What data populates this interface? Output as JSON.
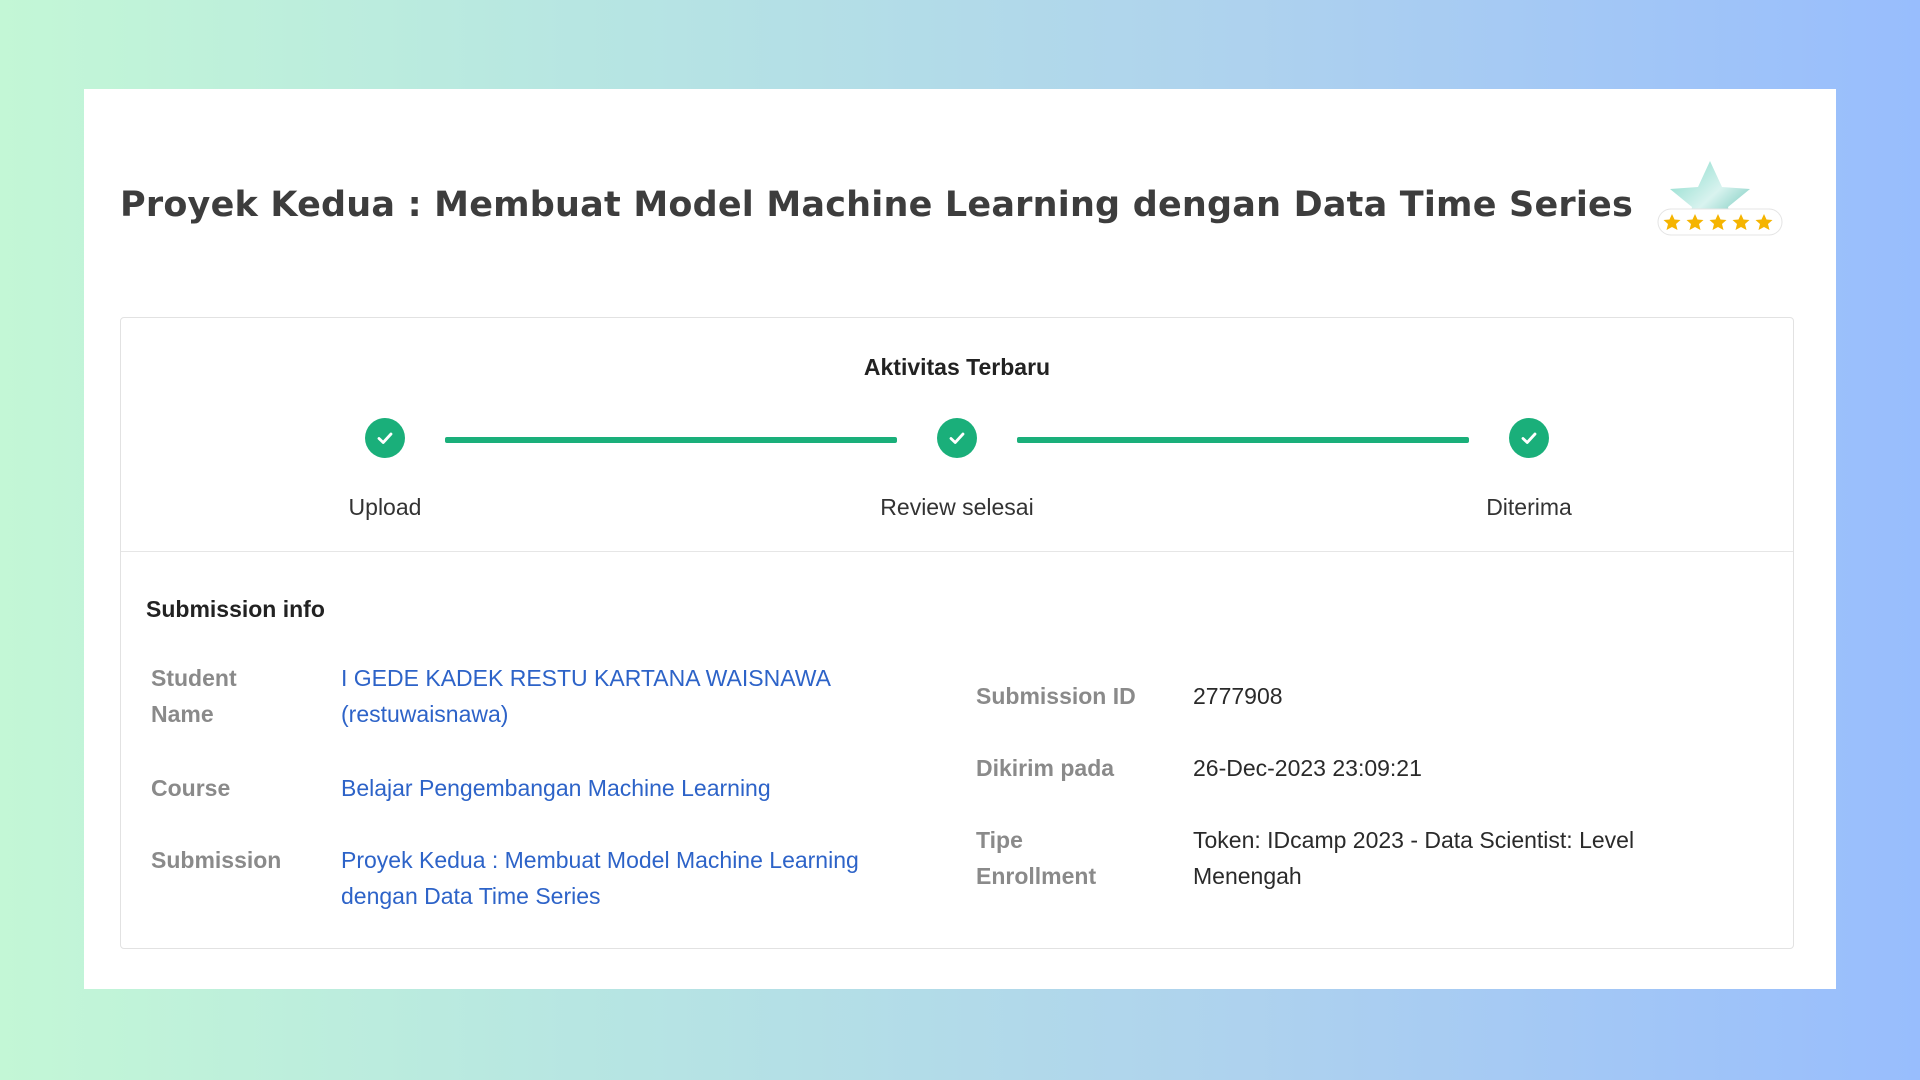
{
  "page": {
    "title": "Proyek Kedua : Membuat Model Machine Learning dengan Data Time Series"
  },
  "activity": {
    "heading": "Aktivitas Terbaru",
    "steps": [
      {
        "label": "Upload",
        "status": "done"
      },
      {
        "label": "Review selesai",
        "status": "done"
      },
      {
        "label": "Diterima",
        "status": "done"
      }
    ]
  },
  "submission_info": {
    "heading": "Submission info",
    "student_name_label": "Student Name",
    "student_name_value": "I GEDE KADEK RESTU KARTANA WAISNAWA (restuwaisnawa)",
    "course_label": "Course",
    "course_value": "Belajar Pengembangan Machine Learning",
    "submission_label": "Submission",
    "submission_value": "Proyek Kedua : Membuat Model Machine Learning dengan Data Time Series",
    "submission_id_label": "Submission ID",
    "submission_id_value": "2777908",
    "sent_at_label": "Dikirim pada",
    "sent_at_value": "26-Dec-2023 23:09:21",
    "enrollment_type_label": "Tipe Enrollment",
    "enrollment_type_value": "Token: IDcamp 2023 - Data Scientist: Level Menengah"
  },
  "badge": {
    "icon": "star-rating-badge-icon",
    "stars": 5
  },
  "colors": {
    "accent": "#1aaf7a",
    "link": "#2d63c8",
    "label": "#8a8a8a",
    "star": "#f5b400"
  }
}
